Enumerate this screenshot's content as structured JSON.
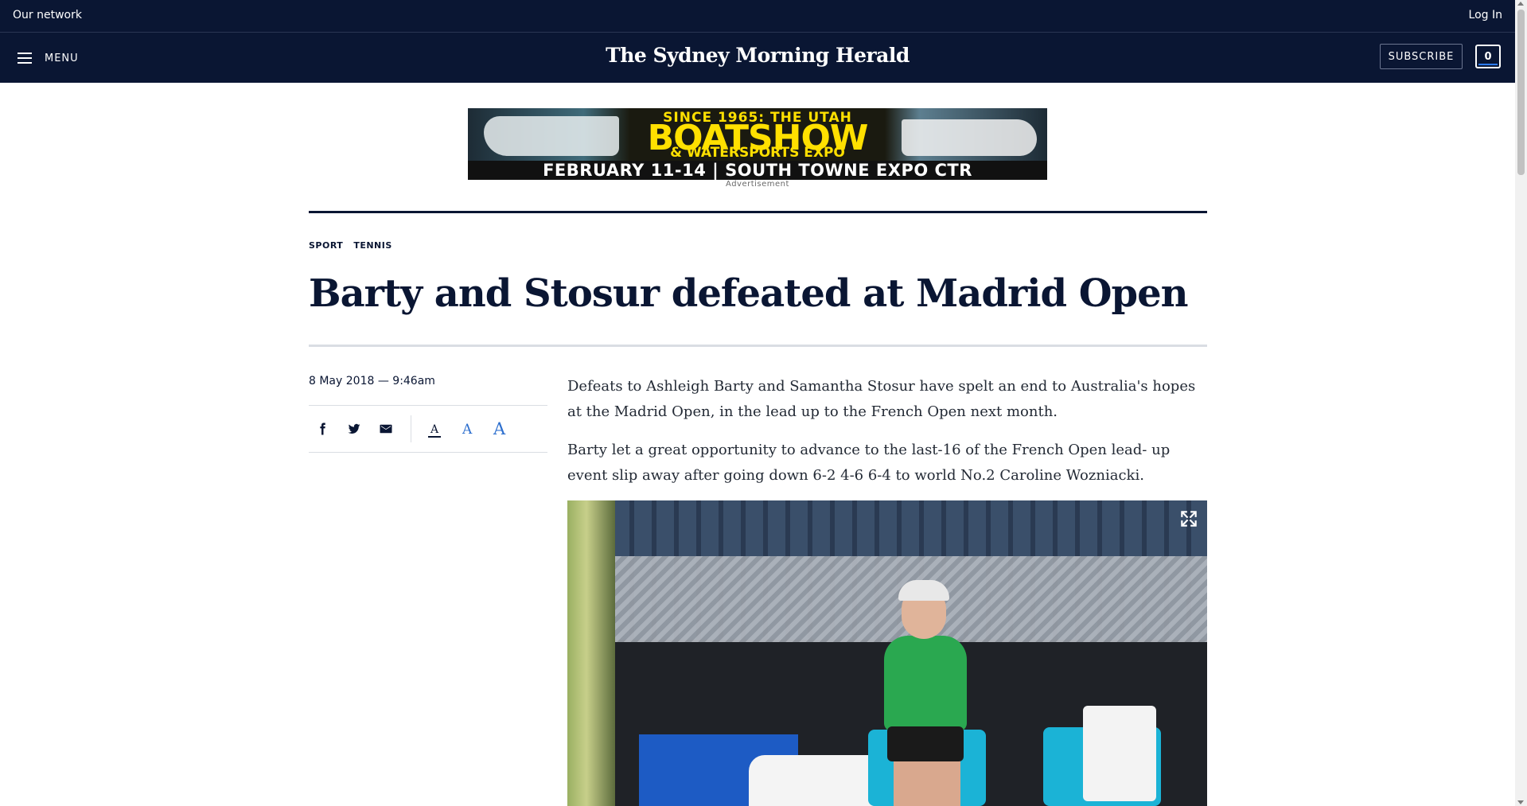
{
  "network_bar": {
    "left_label": "Our network",
    "right_label": "Log In"
  },
  "masthead": {
    "menu_label": "MENU",
    "logo_text": "The Sydney Morning Herald",
    "subscribe_label": "SUBSCRIBE",
    "saved_count": "0"
  },
  "advertisement": {
    "headline_top": "SINCE 1965: THE UTAH",
    "headline_main": "BOATSHOW",
    "headline_sub": "& WATERSPORTS EXPO",
    "footer": "FEBRUARY 11-14 | SOUTH TOWNE EXPO CTR",
    "label": "Advertisement"
  },
  "article": {
    "breadcrumbs": [
      "SPORT",
      "TENNIS"
    ],
    "headline": "Barty and Stosur defeated at Madrid Open",
    "dateline": "8 May 2018 — 9:46am",
    "share_icons": [
      "facebook-icon",
      "twitter-icon",
      "email-icon"
    ],
    "font_size_options": [
      "A",
      "A",
      "A"
    ],
    "paragraphs": [
      "Defeats to Ashleigh Barty and Samantha Stosur have spelt an end to Australia's hopes at the Madrid Open, in the lead up to the French Open next month.",
      "Barty let a great opportunity to advance to the last-16 of the French Open lead- up event slip away after going down 6-2 4-6 6-4 to world No.2 Caroline Wozniacki."
    ]
  },
  "colors": {
    "brand_navy": "#0a1633",
    "link_blue": "#2d6fce",
    "ad_yellow": "#ffe000"
  }
}
